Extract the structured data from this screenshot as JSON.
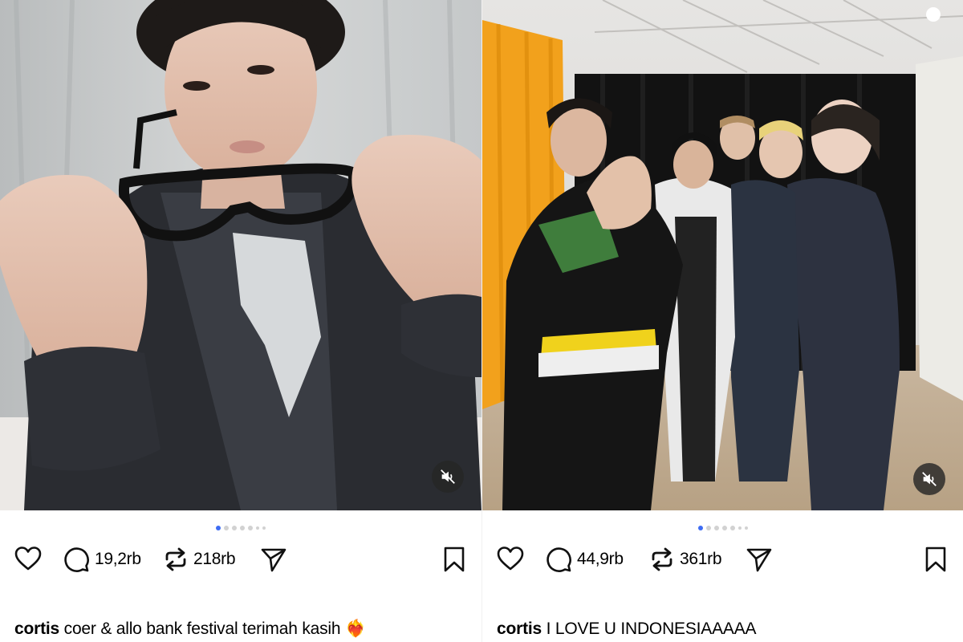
{
  "posts": [
    {
      "username": "cortis",
      "caption": "coer & allo bank festival terimah kasih",
      "caption_emoji": "❤️‍🔥",
      "comments": "19,2rb",
      "reposts": "218rb",
      "carousel": {
        "total": 7,
        "active": 1
      }
    },
    {
      "username": "cortis",
      "caption": "I LOVE U INDONESIAAAAA",
      "comments": "44,9rb",
      "reposts": "361rb",
      "carousel": {
        "total": 7,
        "active": 1
      }
    }
  ],
  "icons": {
    "like": "heart-icon",
    "comment": "speech-bubble-icon",
    "repost": "repost-arrows-icon",
    "share": "paper-plane-icon",
    "save": "bookmark-icon",
    "mute": "speaker-muted-icon"
  },
  "colors": {
    "active_dot": "#3e6cf3",
    "inactive_dot": "#d2d2d2",
    "mute_bg": "#262626"
  }
}
